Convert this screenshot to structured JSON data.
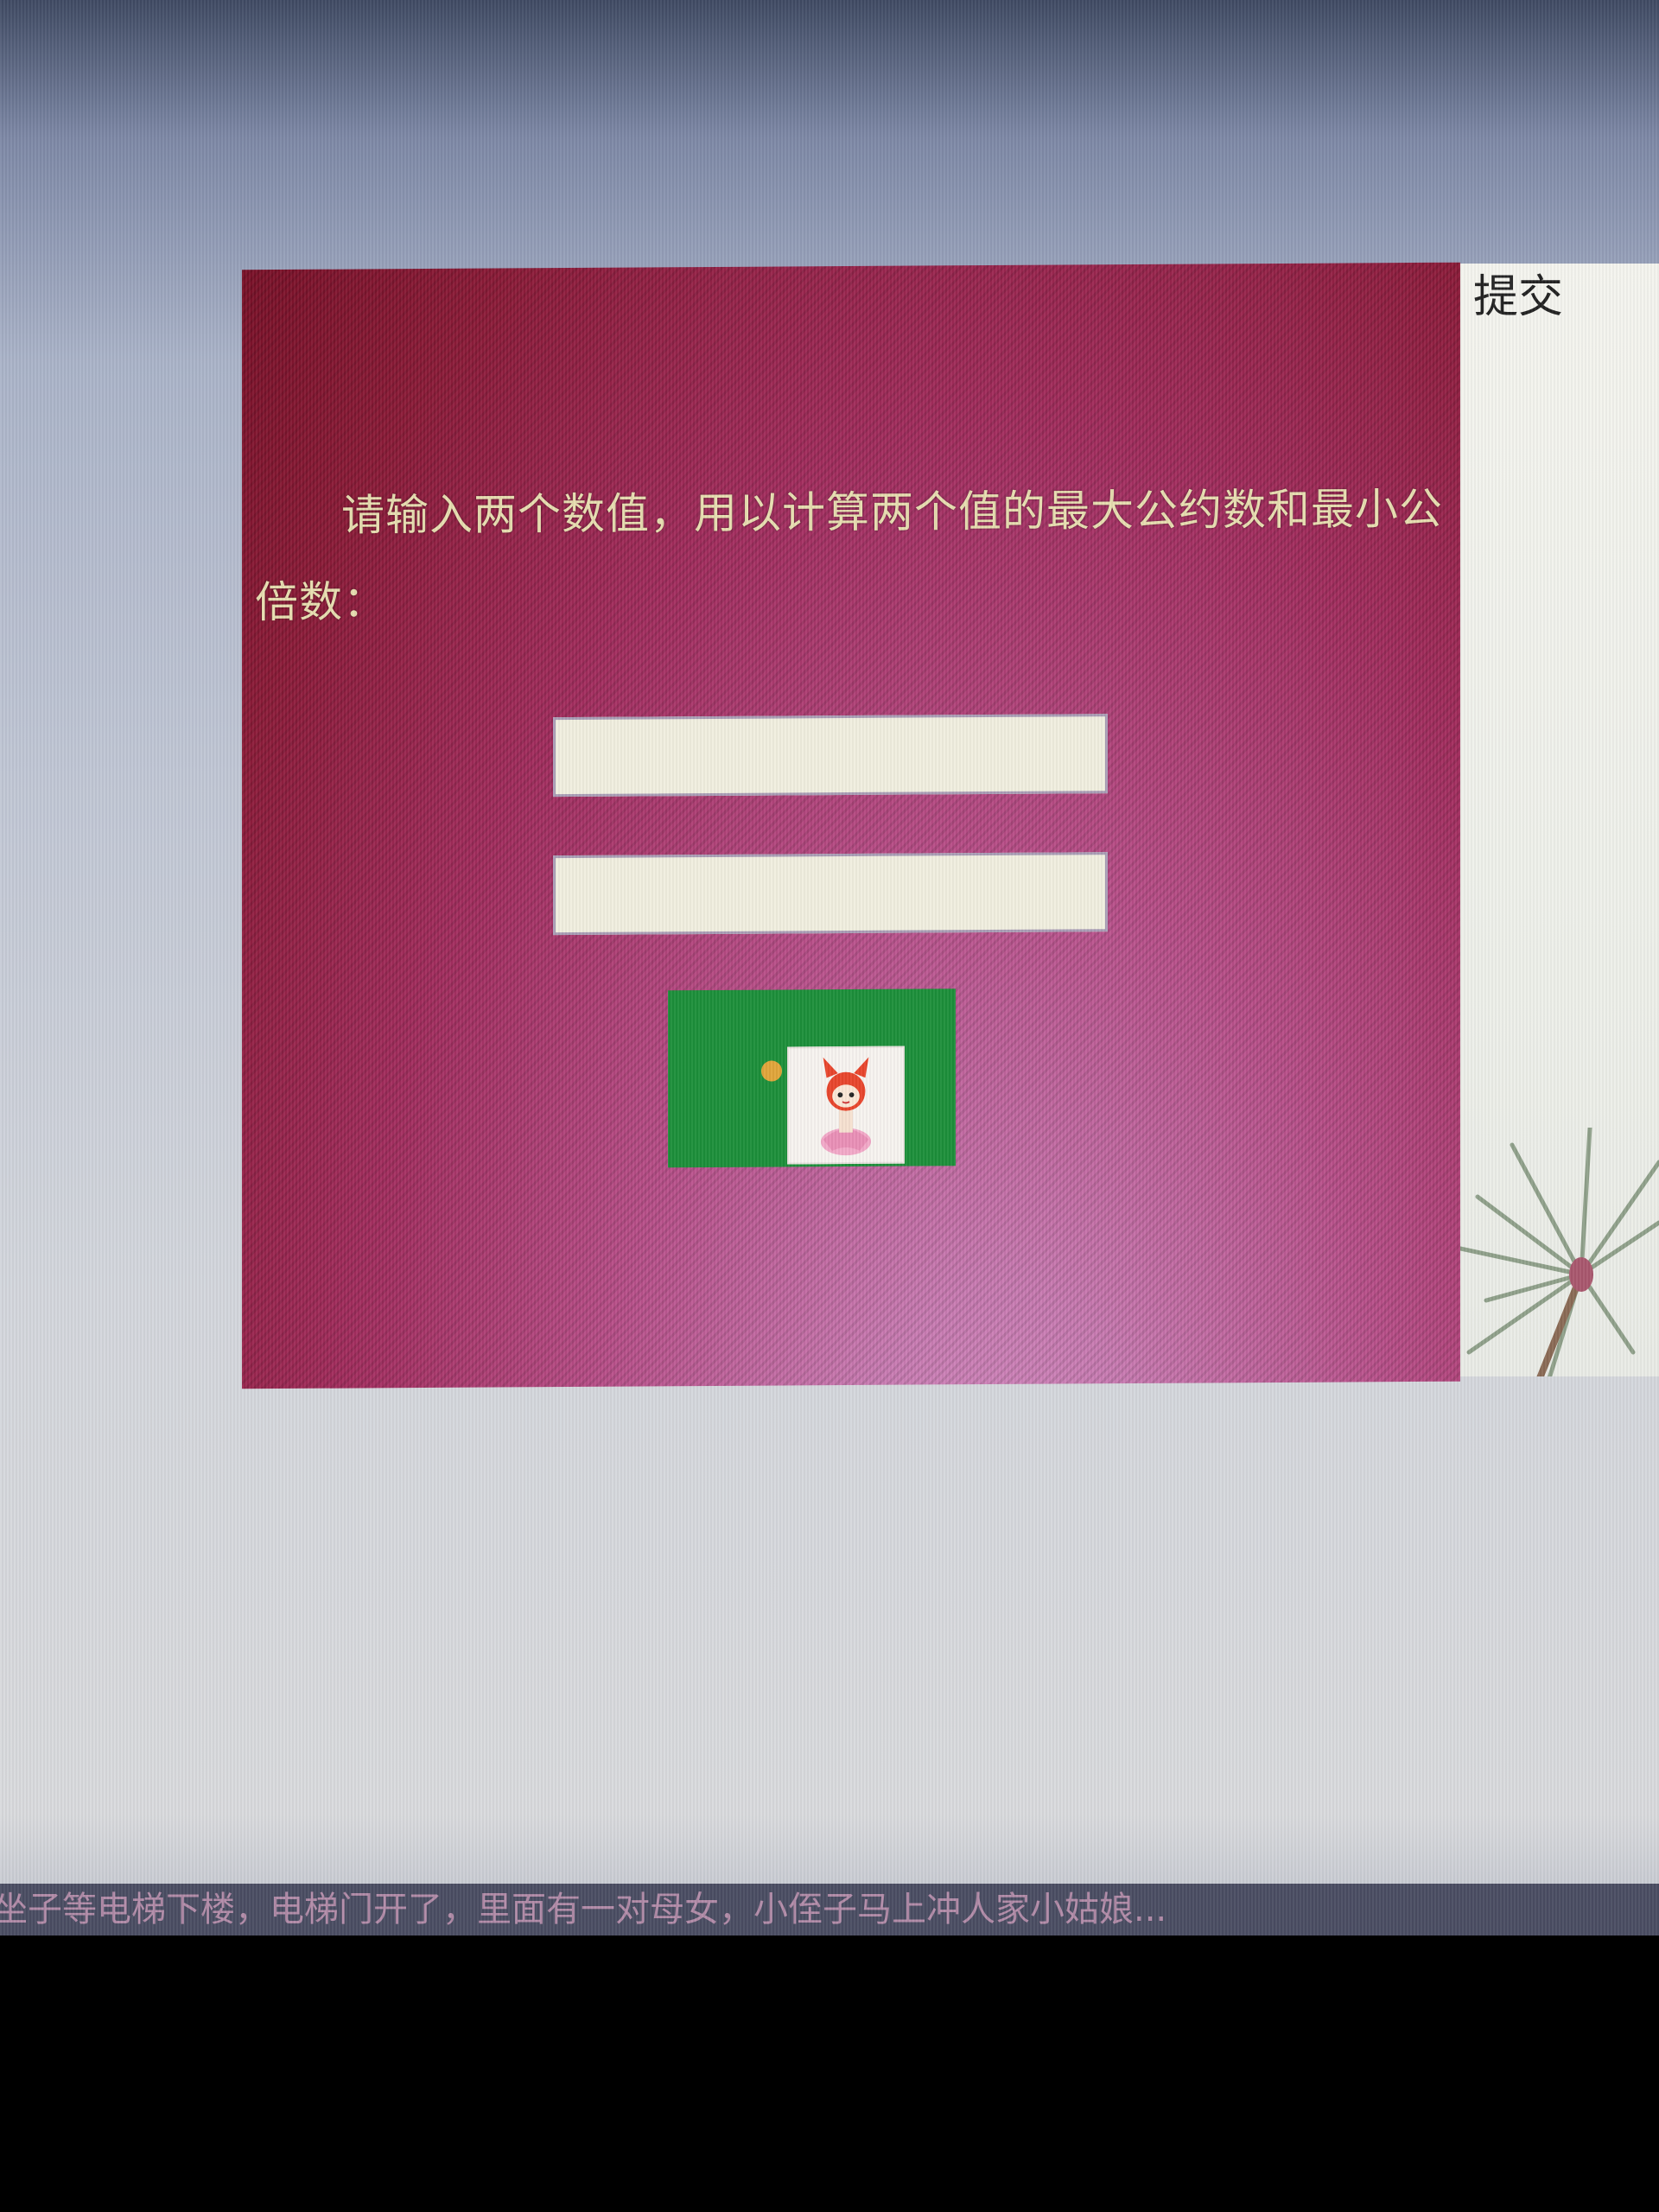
{
  "form": {
    "instruction": "请输入两个数值，用以计算两个值的最大公约数和最小公倍数：",
    "input1_value": "",
    "input2_value": "",
    "submit_label": "提交"
  },
  "news_ticker": {
    "text": "坐子等电梯下楼，电梯门开了，里面有一对母女，小侄子马上冲人家小姑娘..."
  },
  "colors": {
    "panel_dark": "#7a1128",
    "panel_light": "#d590c4",
    "instruction_text": "#e7ddb0",
    "input_background": "#f0eedf",
    "image_button_green": "#1c8f3a"
  },
  "icons": {
    "image_button": "cartoon-girl-icon",
    "decoration": "pine-branch-image"
  }
}
